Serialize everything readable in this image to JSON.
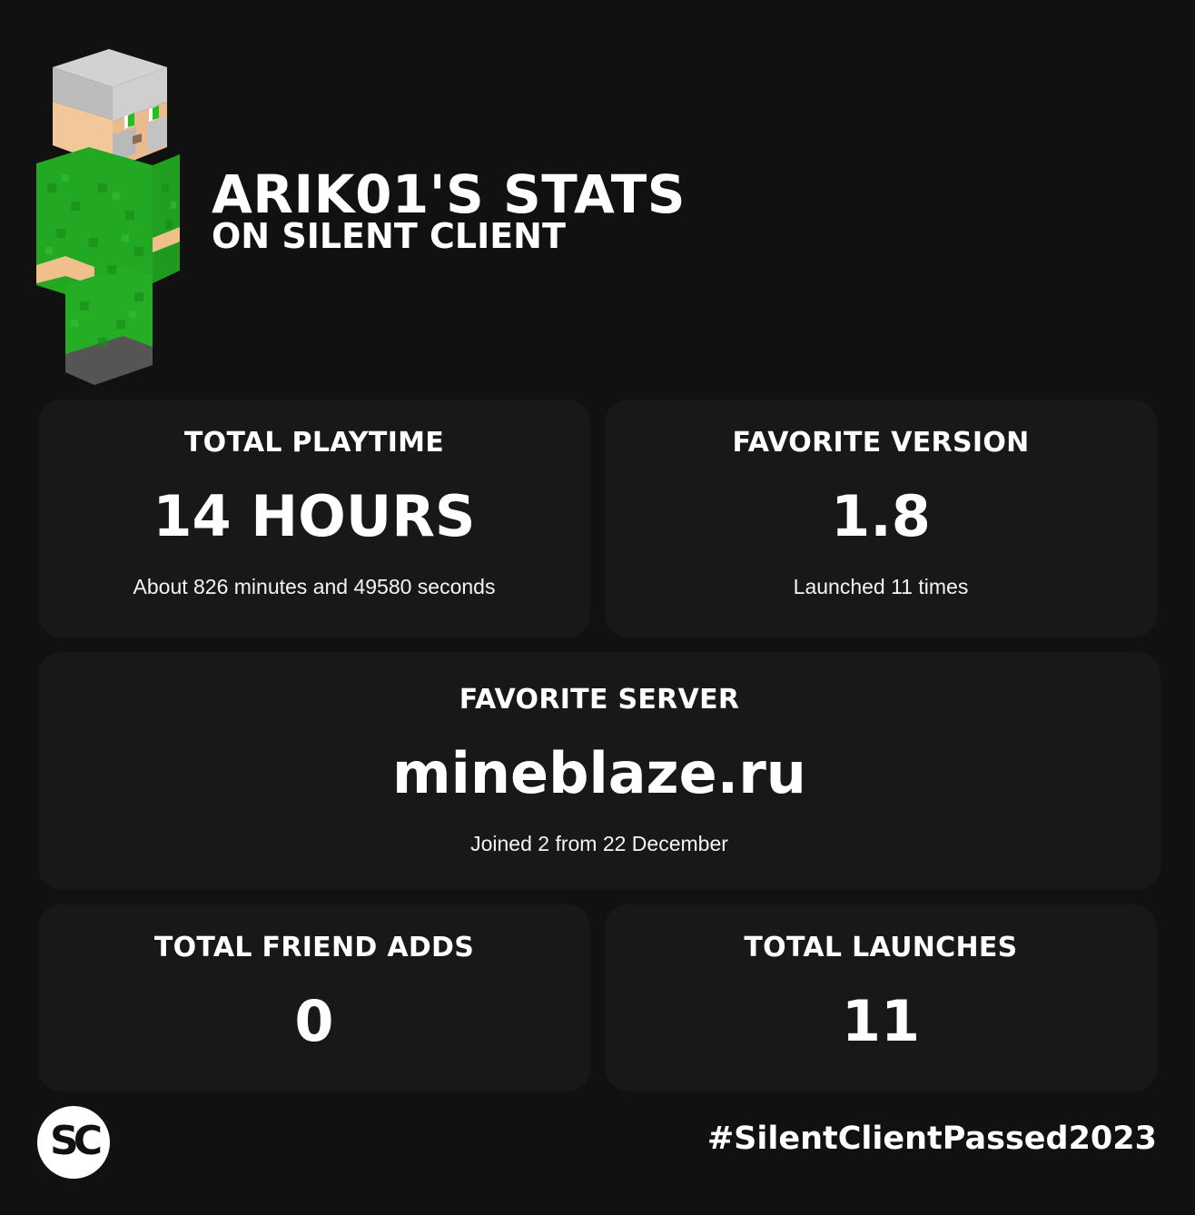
{
  "header": {
    "title": "ARIK01'S STATS",
    "subtitle": "ON SILENT CLIENT",
    "avatar_icon": "minecraft-player-skin-icon"
  },
  "colors": {
    "background": "#111111",
    "card": "#181818",
    "text": "#ffffff",
    "skin_green": "#22a826",
    "hair_gray": "#c8c8c8"
  },
  "cards": {
    "playtime": {
      "label": "TOTAL PLAYTIME",
      "value": "14 HOURS",
      "note": "About 826 minutes and 49580 seconds"
    },
    "version": {
      "label": "FAVORITE VERSION",
      "value": "1.8",
      "note": "Launched 11 times"
    },
    "server": {
      "label": "FAVORITE SERVER",
      "value": "mineblaze.ru",
      "note": "Joined 2 from 22 December"
    },
    "friends": {
      "label": "TOTAL FRIEND ADDS",
      "value": "0"
    },
    "launches": {
      "label": "TOTAL LAUNCHES",
      "value": "11"
    }
  },
  "footer": {
    "logo_text": "SC",
    "logo_icon": "silent-client-logo-icon",
    "hashtag": "#SilentClientPassed2023"
  }
}
